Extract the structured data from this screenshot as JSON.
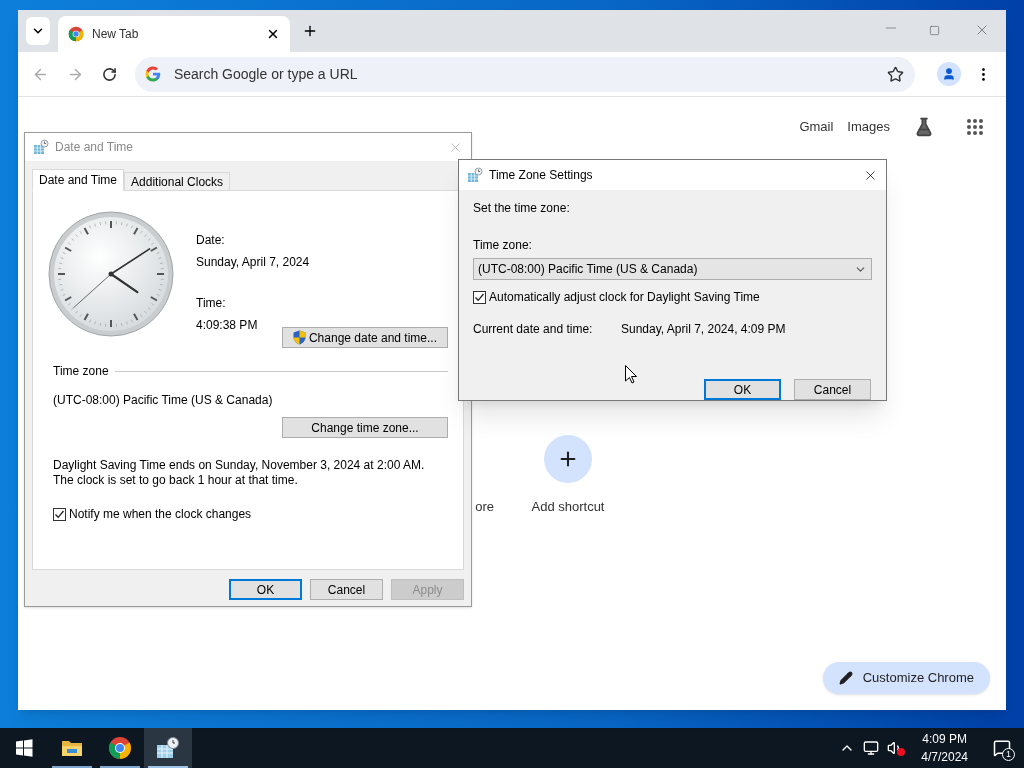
{
  "browser": {
    "tabs": [
      {
        "title": "New Tab",
        "selected": true
      }
    ],
    "omnibox": {
      "placeholder": "Search Google or type a URL"
    },
    "header_links": [
      "Gmail",
      "Images"
    ],
    "shortcuts": [
      {
        "label": "ore",
        "kind": "partial"
      },
      {
        "label": "Add shortcut",
        "kind": "add"
      }
    ],
    "customize_button": "Customize Chrome"
  },
  "date_time_dialog": {
    "title": "Date and Time",
    "active": false,
    "tabs": [
      {
        "label": "Date and Time",
        "selected": true
      },
      {
        "label": "Additional Clocks",
        "selected": false
      }
    ],
    "date_label": "Date:",
    "date": "Sunday, April 7, 2024",
    "time_label": "Time:",
    "time": "4:09:38 PM",
    "change_datetime_button": "Change date and time...",
    "timezone_heading": "Time zone",
    "timezone": "(UTC-08:00) Pacific Time (US & Canada)",
    "change_timezone_button": "Change time zone...",
    "dst_note": "Daylight Saving Time ends on Sunday, November 3, 2024 at 2:00 AM. The clock is set to go back 1 hour at that time.",
    "notify": {
      "label": "Notify me when the clock changes",
      "checked": true
    },
    "buttons": [
      {
        "label": "OK",
        "kind": "default",
        "disabled": false
      },
      {
        "label": "Cancel",
        "kind": "normal",
        "disabled": false
      },
      {
        "label": "Apply",
        "kind": "normal",
        "disabled": true
      }
    ]
  },
  "timezone_dialog": {
    "title": "Time Zone Settings",
    "active": true,
    "prompt": "Set the time zone:",
    "timezone_label": "Time zone:",
    "timezone_value": "(UTC-08:00) Pacific Time (US & Canada)",
    "auto_dst": {
      "label": "Automatically adjust clock for Daylight Saving Time",
      "checked": true
    },
    "current_label": "Current date and time:",
    "current_value": "Sunday, April 7, 2024, 4:09 PM",
    "buttons": [
      {
        "label": "OK",
        "kind": "default",
        "disabled": false
      },
      {
        "label": "Cancel",
        "kind": "normal",
        "disabled": false
      }
    ]
  },
  "taskbar": {
    "apps": [
      {
        "kind": "explorer",
        "running": true,
        "selected": false
      },
      {
        "kind": "chrome",
        "running": true,
        "selected": false
      },
      {
        "kind": "datetime",
        "running": true,
        "selected": true
      }
    ],
    "clock_time": "4:09 PM",
    "clock_date": "4/7/2024",
    "notification_count": "1"
  }
}
